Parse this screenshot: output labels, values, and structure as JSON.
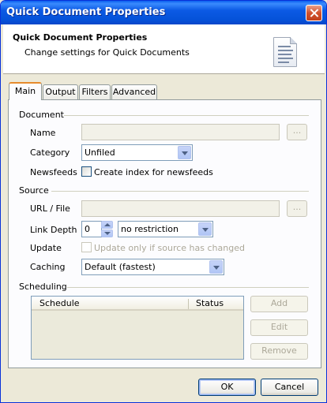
{
  "window": {
    "title": "Quick Document Properties"
  },
  "header": {
    "title": "Quick Document Properties",
    "subtitle": "Change settings for Quick Documents"
  },
  "tabs": [
    "Main",
    "Output",
    "Filters",
    "Advanced"
  ],
  "document_section": {
    "label": "Document",
    "name_label": "Name",
    "name_value": "",
    "browse_label": "...",
    "category_label": "Category",
    "category_value": "Unfiled",
    "newsfeeds_label": "Newsfeeds",
    "newsfeeds_checkbox": "Create index for newsfeeds"
  },
  "source_section": {
    "label": "Source",
    "url_label": "URL / File",
    "url_value": "",
    "browse_label": "...",
    "link_depth_label": "Link Depth",
    "link_depth_value": "0",
    "restriction_value": "no restriction",
    "update_label": "Update",
    "update_checkbox": "Update only if source has changed",
    "caching_label": "Caching",
    "caching_value": "Default (fastest)"
  },
  "scheduling_section": {
    "label": "Scheduling",
    "columns": [
      "Schedule",
      "Status"
    ],
    "add_label": "Add",
    "edit_label": "Edit",
    "remove_label": "Remove"
  },
  "footer": {
    "ok_label": "OK",
    "cancel_label": "Cancel"
  },
  "colors": {
    "titlebar": "#0552d9",
    "active_tab_accent": "#e68b2c",
    "dialog_bg": "#ece9d8"
  }
}
